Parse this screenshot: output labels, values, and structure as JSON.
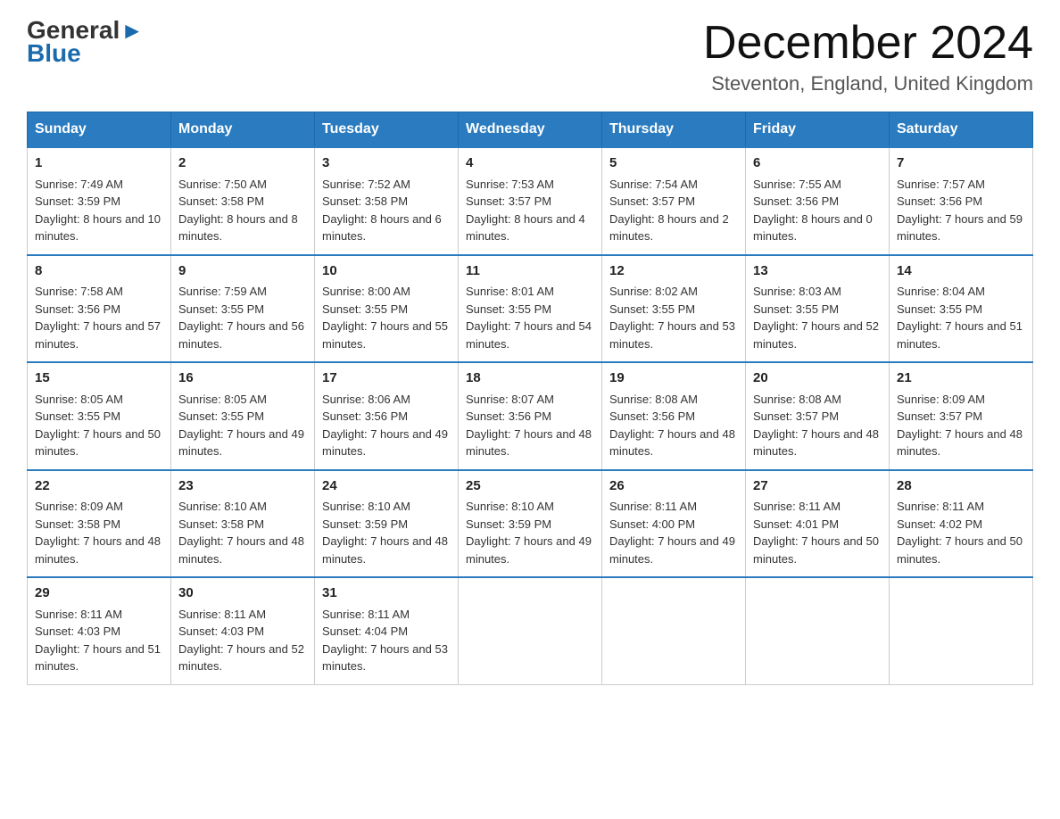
{
  "logo": {
    "general": "General",
    "arrow": "▶",
    "blue": "Blue"
  },
  "header": {
    "month_year": "December 2024",
    "location": "Steventon, England, United Kingdom"
  },
  "weekdays": [
    "Sunday",
    "Monday",
    "Tuesday",
    "Wednesday",
    "Thursday",
    "Friday",
    "Saturday"
  ],
  "weeks": [
    [
      {
        "day": "1",
        "sunrise": "7:49 AM",
        "sunset": "3:59 PM",
        "daylight": "8 hours and 10 minutes."
      },
      {
        "day": "2",
        "sunrise": "7:50 AM",
        "sunset": "3:58 PM",
        "daylight": "8 hours and 8 minutes."
      },
      {
        "day": "3",
        "sunrise": "7:52 AM",
        "sunset": "3:58 PM",
        "daylight": "8 hours and 6 minutes."
      },
      {
        "day": "4",
        "sunrise": "7:53 AM",
        "sunset": "3:57 PM",
        "daylight": "8 hours and 4 minutes."
      },
      {
        "day": "5",
        "sunrise": "7:54 AM",
        "sunset": "3:57 PM",
        "daylight": "8 hours and 2 minutes."
      },
      {
        "day": "6",
        "sunrise": "7:55 AM",
        "sunset": "3:56 PM",
        "daylight": "8 hours and 0 minutes."
      },
      {
        "day": "7",
        "sunrise": "7:57 AM",
        "sunset": "3:56 PM",
        "daylight": "7 hours and 59 minutes."
      }
    ],
    [
      {
        "day": "8",
        "sunrise": "7:58 AM",
        "sunset": "3:56 PM",
        "daylight": "7 hours and 57 minutes."
      },
      {
        "day": "9",
        "sunrise": "7:59 AM",
        "sunset": "3:55 PM",
        "daylight": "7 hours and 56 minutes."
      },
      {
        "day": "10",
        "sunrise": "8:00 AM",
        "sunset": "3:55 PM",
        "daylight": "7 hours and 55 minutes."
      },
      {
        "day": "11",
        "sunrise": "8:01 AM",
        "sunset": "3:55 PM",
        "daylight": "7 hours and 54 minutes."
      },
      {
        "day": "12",
        "sunrise": "8:02 AM",
        "sunset": "3:55 PM",
        "daylight": "7 hours and 53 minutes."
      },
      {
        "day": "13",
        "sunrise": "8:03 AM",
        "sunset": "3:55 PM",
        "daylight": "7 hours and 52 minutes."
      },
      {
        "day": "14",
        "sunrise": "8:04 AM",
        "sunset": "3:55 PM",
        "daylight": "7 hours and 51 minutes."
      }
    ],
    [
      {
        "day": "15",
        "sunrise": "8:05 AM",
        "sunset": "3:55 PM",
        "daylight": "7 hours and 50 minutes."
      },
      {
        "day": "16",
        "sunrise": "8:05 AM",
        "sunset": "3:55 PM",
        "daylight": "7 hours and 49 minutes."
      },
      {
        "day": "17",
        "sunrise": "8:06 AM",
        "sunset": "3:56 PM",
        "daylight": "7 hours and 49 minutes."
      },
      {
        "day": "18",
        "sunrise": "8:07 AM",
        "sunset": "3:56 PM",
        "daylight": "7 hours and 48 minutes."
      },
      {
        "day": "19",
        "sunrise": "8:08 AM",
        "sunset": "3:56 PM",
        "daylight": "7 hours and 48 minutes."
      },
      {
        "day": "20",
        "sunrise": "8:08 AM",
        "sunset": "3:57 PM",
        "daylight": "7 hours and 48 minutes."
      },
      {
        "day": "21",
        "sunrise": "8:09 AM",
        "sunset": "3:57 PM",
        "daylight": "7 hours and 48 minutes."
      }
    ],
    [
      {
        "day": "22",
        "sunrise": "8:09 AM",
        "sunset": "3:58 PM",
        "daylight": "7 hours and 48 minutes."
      },
      {
        "day": "23",
        "sunrise": "8:10 AM",
        "sunset": "3:58 PM",
        "daylight": "7 hours and 48 minutes."
      },
      {
        "day": "24",
        "sunrise": "8:10 AM",
        "sunset": "3:59 PM",
        "daylight": "7 hours and 48 minutes."
      },
      {
        "day": "25",
        "sunrise": "8:10 AM",
        "sunset": "3:59 PM",
        "daylight": "7 hours and 49 minutes."
      },
      {
        "day": "26",
        "sunrise": "8:11 AM",
        "sunset": "4:00 PM",
        "daylight": "7 hours and 49 minutes."
      },
      {
        "day": "27",
        "sunrise": "8:11 AM",
        "sunset": "4:01 PM",
        "daylight": "7 hours and 50 minutes."
      },
      {
        "day": "28",
        "sunrise": "8:11 AM",
        "sunset": "4:02 PM",
        "daylight": "7 hours and 50 minutes."
      }
    ],
    [
      {
        "day": "29",
        "sunrise": "8:11 AM",
        "sunset": "4:03 PM",
        "daylight": "7 hours and 51 minutes."
      },
      {
        "day": "30",
        "sunrise": "8:11 AM",
        "sunset": "4:03 PM",
        "daylight": "7 hours and 52 minutes."
      },
      {
        "day": "31",
        "sunrise": "8:11 AM",
        "sunset": "4:04 PM",
        "daylight": "7 hours and 53 minutes."
      },
      null,
      null,
      null,
      null
    ]
  ],
  "labels": {
    "sunrise": "Sunrise:",
    "sunset": "Sunset:",
    "daylight": "Daylight:"
  }
}
